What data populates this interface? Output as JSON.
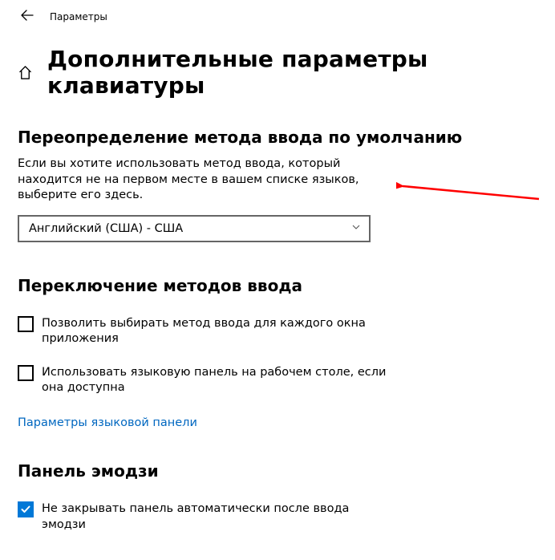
{
  "window": {
    "title": "Параметры"
  },
  "page": {
    "title": "Дополнительные параметры клавиатуры"
  },
  "override": {
    "heading": "Переопределение метода ввода по умолчанию",
    "description": "Если вы хотите использовать метод ввода, который находится не на первом месте в вашем списке языков, выберите его здесь.",
    "dropdown_value": "Английский (США) - США"
  },
  "switching": {
    "heading": "Переключение методов ввода",
    "checkbox_per_window": "Позволить выбирать метод ввода для каждого окна приложения",
    "checkbox_lang_bar": "Использовать языковую панель на рабочем столе, если она доступна",
    "link": "Параметры языковой панели"
  },
  "emoji": {
    "heading": "Панель эмодзи",
    "checkbox_dont_close": "Не закрывать панель автоматически после ввода эмодзи"
  },
  "colors": {
    "accent": "#0078d7",
    "link": "#0067c0",
    "arrow": "#ff0000"
  }
}
